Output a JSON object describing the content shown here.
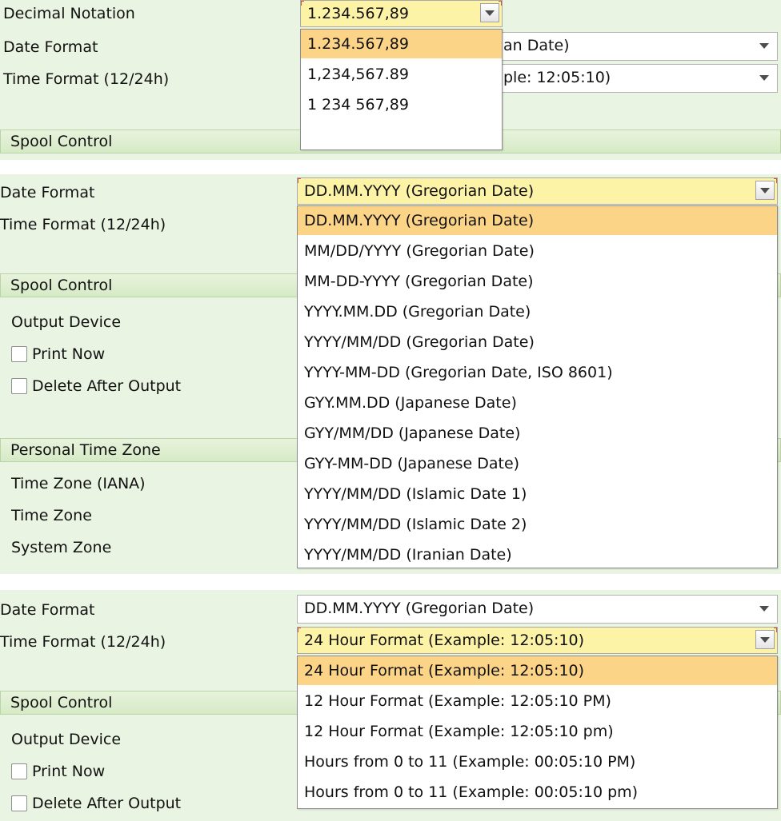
{
  "panel1": {
    "decimal_label": "Decimal Notation",
    "decimal_value": "1.234.567,89",
    "date_label": "Date Format",
    "date_partial": "an Date)",
    "time_label": "Time Format (12/24h)",
    "time_partial": "ple: 12:05:10)",
    "spool_header": "Spool Control",
    "decimal_options": [
      "1.234.567,89",
      "1,234,567.89",
      "1 234 567,89"
    ]
  },
  "panel2": {
    "date_label": "Date Format",
    "date_value": "DD.MM.YYYY (Gregorian Date)",
    "time_label": "Time Format (12/24h)",
    "spool_header": "Spool Control",
    "output_device_label": "Output Device",
    "print_now_label": "Print Now",
    "delete_after_label": "Delete After Output",
    "tz_header": "Personal Time Zone",
    "tz_iana_label": "Time Zone (IANA)",
    "tz_label": "Time Zone",
    "system_zone_label": "System Zone",
    "date_options": [
      "DD.MM.YYYY (Gregorian Date)",
      "MM/DD/YYYY (Gregorian Date)",
      "MM-DD-YYYY (Gregorian Date)",
      "YYYY.MM.DD (Gregorian Date)",
      "YYYY/MM/DD (Gregorian Date)",
      "YYYY-MM-DD (Gregorian Date, ISO 8601)",
      "GYY.MM.DD (Japanese Date)",
      "GYY/MM/DD (Japanese Date)",
      "GYY-MM-DD (Japanese Date)",
      "YYYY/MM/DD (Islamic Date 1)",
      "YYYY/MM/DD (Islamic Date 2)",
      "YYYY/MM/DD (Iranian Date)"
    ]
  },
  "panel3": {
    "date_label": "Date Format",
    "date_value": "DD.MM.YYYY (Gregorian Date)",
    "time_label": "Time Format (12/24h)",
    "time_value": "24 Hour Format (Example: 12:05:10)",
    "spool_header": "Spool Control",
    "output_device_label": "Output Device",
    "print_now_label": "Print Now",
    "delete_after_label": "Delete After Output",
    "time_options": [
      "24 Hour Format (Example: 12:05:10)",
      "12 Hour Format (Example: 12:05:10 PM)",
      "12 Hour Format (Example: 12:05:10 pm)",
      "Hours from 0 to 11 (Example: 00:05:10 PM)",
      "Hours from 0 to 11 (Example: 00:05:10 pm)"
    ]
  },
  "colors": {
    "panel_bg": "#eaf4e2",
    "active_field_bg": "#fdf3a6",
    "selected_option_bg": "#fcd488",
    "focus_marker": "#d4523a"
  },
  "icons": {
    "dropdown_caret": "chevron-down-icon",
    "checkbox": "checkbox-unchecked-icon"
  }
}
